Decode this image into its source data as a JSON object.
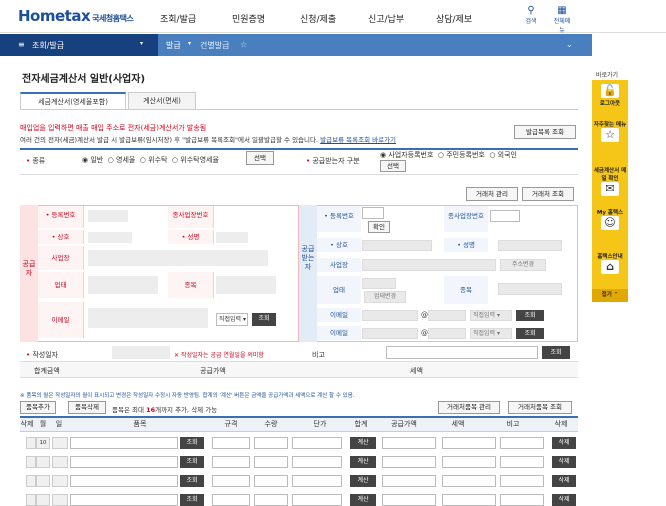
{
  "header": {
    "logo_main": "Hometax",
    "logo_sub": "국세청홈택스",
    "menus": [
      "조회/발급",
      "민원증명",
      "신청/제출",
      "신고/납부",
      "상담/제보"
    ],
    "search_label": "검색",
    "allmenu_label": "전체메뉴"
  },
  "nav": {
    "section": "조회/발급",
    "crumb1": "발급",
    "crumb2": "건별발급"
  },
  "page": {
    "title": "전자세금계산서 일반(사업자)",
    "tab1": "세금계산서(영세율포함)",
    "tab2": "계산서(면세)"
  },
  "notice": {
    "red": "매입업을 입력하면 매출 매입 주소로 전자(세금)계산서가 발송됨",
    "info": "여러 건의 전자(세금)계산서 발급 시 발급보류(임시저장) 후 \"발급보류 목록조회\"에서 일괄발급할 수 있습니다.",
    "link": "발급보류 목록조회 바로가기",
    "list_btn": "발급목록 조회"
  },
  "kind": {
    "label": "종류",
    "options": [
      "일반",
      "영세율",
      "위수탁",
      "위수탁영세율"
    ],
    "select_btn": "선택",
    "receiver_label": "공급받는자 구분",
    "receiver_options": [
      "사업자등록번호",
      "주민등록번호",
      "외국인"
    ],
    "receiver_btn": "선택"
  },
  "partner": {
    "manage_btn": "거래처 관리",
    "lookup_btn": "거래처 조회"
  },
  "supplier": {
    "side": "공급자",
    "reg_no": "등록번호",
    "branch_no": "종사업장번호",
    "name": "상호",
    "ceo": "성명",
    "address": "사업장",
    "type": "업태",
    "item": "종목",
    "email": "이메일",
    "email_select": "직접입력",
    "lookup": "조회"
  },
  "receiver": {
    "side": "공급받는자",
    "reg_no": "등록번호",
    "branch_no": "종사업장번호",
    "confirm": "확인",
    "name": "상호",
    "ceo": "성명",
    "address": "사업장",
    "address_btn": "주소변경",
    "type": "업태",
    "type_btn": "업태변경",
    "item": "종목",
    "email": "이메일",
    "at": "@",
    "email_select": "직접입력",
    "lookup": "조회"
  },
  "dates": {
    "write_label": "작성일자",
    "write_note": "작성일자는 공급 연월일을 의미함",
    "memo_label": "비고",
    "lookup": "조회"
  },
  "totals": {
    "sum_label": "합계금액",
    "supply_label": "공급가액",
    "tax_label": "세액"
  },
  "items": {
    "note": "※ 품목의 월은 작성일자의 월이 표시되고 변경은 작성일자 수정시 자동 반영됨. 합계의 '계산' 버튼은 금액을 공급가액과 세액으로 계산 할 수 있음.",
    "add_btn": "품목추가",
    "del_btn": "품목삭제",
    "count_text": "품목은 최대",
    "max": "16",
    "count_suffix": "개까지 추가, 삭제 가능",
    "manage_btn": "거래처품목 관리",
    "lookup_btn": "거래처품목 조회",
    "headers": [
      "삭제",
      "월",
      "일",
      "품목",
      "규격",
      "수량",
      "단가",
      "합계",
      "공급가액",
      "세액",
      "비고",
      "삭제"
    ],
    "month_value": "10",
    "row_lookup": "조회",
    "row_calc": "계산",
    "row_delete": "삭제"
  },
  "sidebar": {
    "header": "바로가기",
    "items": [
      "로그아웃",
      "자주찾는 메뉴",
      "세금계산서 메일 확인",
      "My 홈택스",
      "홈택스안내"
    ],
    "close": "접기"
  }
}
